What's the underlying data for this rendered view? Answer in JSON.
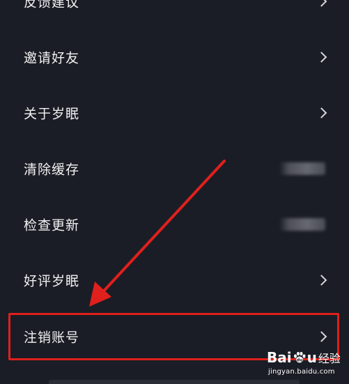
{
  "menu": {
    "items": [
      {
        "label": "反馈建议",
        "trailing": "chevron"
      },
      {
        "label": "邀请好友",
        "trailing": "chevron"
      },
      {
        "label": "关于岁眠",
        "trailing": "chevron"
      },
      {
        "label": "清除缓存",
        "trailing": "blurred-value"
      },
      {
        "label": "检查更新",
        "trailing": "blurred-value"
      },
      {
        "label": "好评岁眠",
        "trailing": "chevron"
      },
      {
        "label": "注销账号",
        "trailing": "chevron"
      }
    ]
  },
  "annotation": {
    "highlight_color": "#e0201c",
    "highlighted_item": "注销账号"
  },
  "watermark": {
    "brand_left": "Bai",
    "brand_right": "u",
    "suffix": "经验",
    "url": "jingyan.baidu.com"
  },
  "colors": {
    "background": "#1b1d26",
    "text": "#f2f2f2",
    "chevron": "#d8d8d8"
  }
}
